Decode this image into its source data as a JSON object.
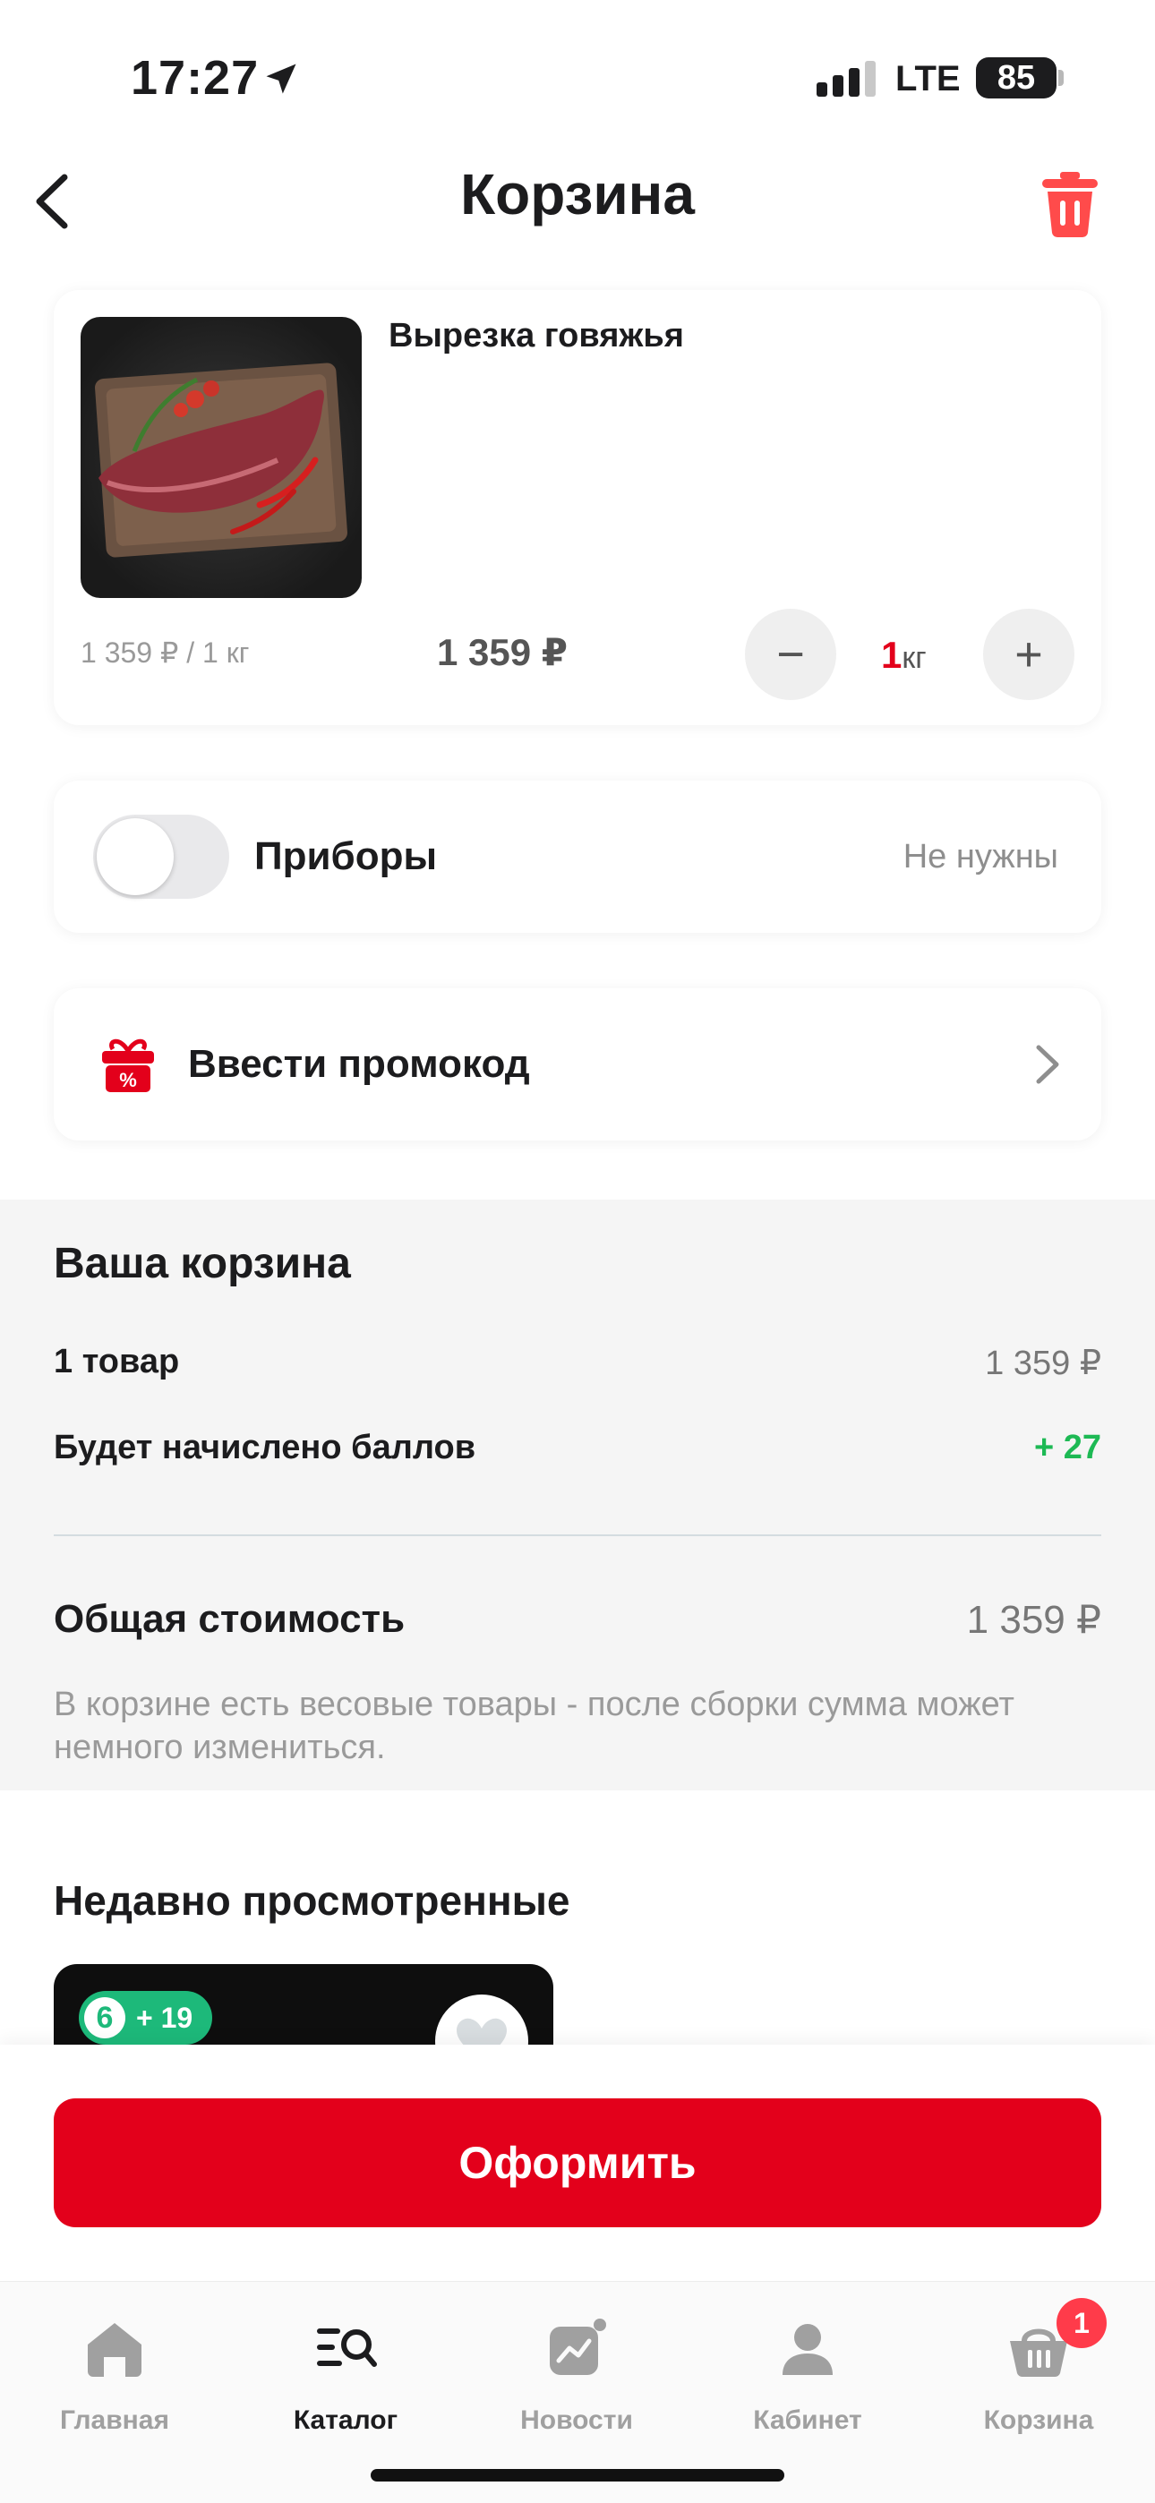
{
  "status_bar": {
    "time": "17:27",
    "network": "LTE",
    "battery": "85"
  },
  "header": {
    "title": "Корзина"
  },
  "product": {
    "name": "Вырезка говяжья",
    "unit_price": "1 359 ₽ / 1 кг",
    "total_price": "1 359 ₽",
    "quantity": "1",
    "quantity_unit": "кг",
    "minus_label": "−",
    "plus_label": "+"
  },
  "cutlery": {
    "label": "Приборы",
    "value": "Не нужны",
    "enabled": false
  },
  "promo": {
    "label": "Ввести промокод"
  },
  "summary": {
    "title": "Ваша корзина",
    "items_label": "1 товар",
    "items_value": "1 359 ₽",
    "points_label": "Будет начислено баллов",
    "points_value": "+ 27",
    "total_label": "Общая стоимость",
    "total_value": "1 359 ₽",
    "note": "В корзине есть весовые товары - после сборки сумма может немного измениться."
  },
  "recent": {
    "title": "Недавно просмотренные",
    "badge_number": "6",
    "badge_points": "+ 19"
  },
  "checkout": {
    "label": "Оформить"
  },
  "tabbar": {
    "items": [
      {
        "label": "Главная",
        "icon": "home-icon"
      },
      {
        "label": "Каталог",
        "icon": "catalog-search-icon"
      },
      {
        "label": "Новости",
        "icon": "news-icon"
      },
      {
        "label": "Кабинет",
        "icon": "profile-icon"
      },
      {
        "label": "Корзина",
        "icon": "basket-icon"
      }
    ],
    "active_index": 1,
    "cart_count": "1"
  },
  "colors": {
    "accent": "#e3001b",
    "points_green": "#1db954",
    "badge_red": "#ff3b4a"
  }
}
